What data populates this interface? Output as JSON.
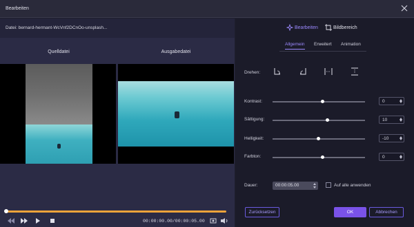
{
  "window": {
    "title": "Bearbeiten"
  },
  "file": {
    "label": "Datei: bernard-hermant-WcVnf2DCnOo-unsplash..."
  },
  "preview": {
    "source_label": "Quelldatei",
    "output_label": "Ausgabedatei"
  },
  "player": {
    "time": "00:00:00.00/00:00:05.00",
    "progress": 1.0
  },
  "top_tabs": [
    {
      "label": "Bearbeiten",
      "icon": "edit-icon",
      "active": true
    },
    {
      "label": "Bildbereich",
      "icon": "crop-icon",
      "active": false
    }
  ],
  "sub_tabs": [
    {
      "label": "Allgemein",
      "active": true
    },
    {
      "label": "Erweitert",
      "active": false
    },
    {
      "label": "Animation",
      "active": false
    }
  ],
  "rotate": {
    "label": "Drehen:",
    "buttons": [
      "rotate-right-icon",
      "rotate-left-icon",
      "flip-horizontal-icon",
      "flip-vertical-icon"
    ]
  },
  "adjustments": [
    {
      "label": "Kontrast:",
      "value": "0",
      "fraction": 0.54
    },
    {
      "label": "Sättigung:",
      "value": "10",
      "fraction": 0.59
    },
    {
      "label": "Helligkeit:",
      "value": "-10",
      "fraction": 0.49
    },
    {
      "label": "Farbton:",
      "value": "0",
      "fraction": 0.54
    }
  ],
  "duration": {
    "label": "Dauer:",
    "value": "00:00:05.00",
    "apply_all_label": "Auf alle anwenden",
    "apply_all_checked": false
  },
  "buttons": {
    "reset": "Zurücksetzen",
    "ok": "OK",
    "cancel": "Abbrechen"
  },
  "colors": {
    "accent": "#7a52e8",
    "progress": "#f0a33a"
  }
}
